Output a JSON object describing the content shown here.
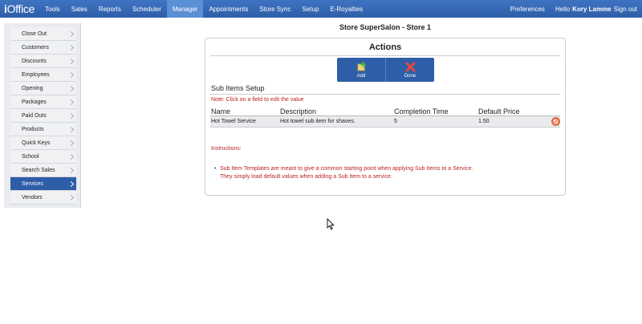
{
  "app": {
    "logo_i": "i",
    "logo_rest": "Office"
  },
  "nav": {
    "items": [
      "Tools",
      "Sales",
      "Reports",
      "Scheduler",
      "Manager",
      "Appointments",
      "Store Sync",
      "Setup",
      "E-Royalties"
    ],
    "active": "Manager",
    "preferences": "Preferences",
    "hello": "Hello",
    "user_name": "Kory Lamme",
    "sign_out": "Sign out"
  },
  "sidebar": {
    "items": [
      "Close Out",
      "Customers",
      "Discounts",
      "Employees",
      "Opening",
      "Packages",
      "Paid Outs",
      "Products",
      "Quick Keys",
      "School",
      "Search Sales",
      "Services",
      "Vendors"
    ],
    "active": "Services"
  },
  "store_title": "Store SuperSalon - Store 1",
  "panel": {
    "title": "Actions",
    "add_label": "Add",
    "done_label": "Done",
    "section_title": "Sub Items Setup",
    "note": "Note: Click on a field to edit the value",
    "columns": [
      "Name",
      "Description",
      "Completion Time",
      "Default Price"
    ],
    "rows": [
      {
        "name": "Hot Towel Service",
        "description": "Hot towel sub item for shaves.",
        "completion_time": "5",
        "default_price": "1.50"
      }
    ],
    "instructions_title": "Instructions:",
    "instructions": [
      "Sub Item Templates are meant to give a common starting point when applying Sub Items to a Service.",
      "They simply load default values when adding a Sub Item to a service."
    ]
  },
  "colors": {
    "nav_bg": "#2e5ea8",
    "nav_active": "#5b8fd6",
    "alert_text": "#bb2222",
    "delete_icon": "#e16a3f"
  }
}
